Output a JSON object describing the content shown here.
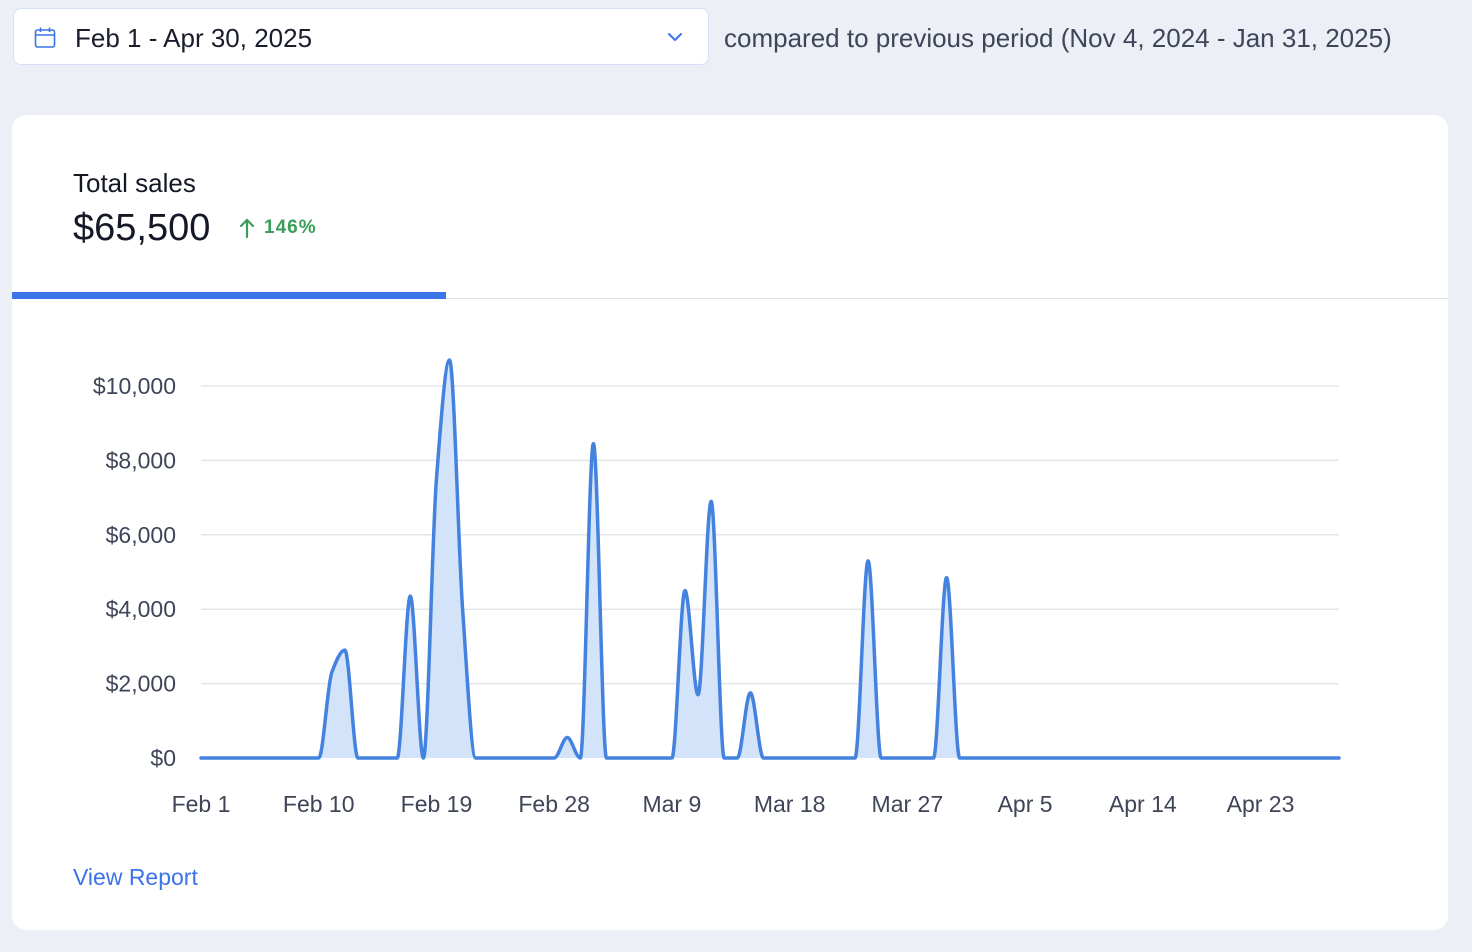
{
  "date_range": {
    "label": "Feb 1 - Apr 30, 2025",
    "icon": "calendar-icon",
    "dropdown_icon": "chevron-down-icon"
  },
  "comparison": {
    "text": "compared to previous period (Nov 4, 2024 - Jan 31, 2025)"
  },
  "metric": {
    "title": "Total sales",
    "value": "$65,500",
    "change": "146%",
    "change_icon": "arrow-up-icon"
  },
  "colors": {
    "accent": "#3b73e8",
    "line": "#4382de",
    "fill": "#d3e3fa",
    "positive": "#3a9d5a"
  },
  "chart_data": {
    "type": "area",
    "title": "",
    "xlabel": "",
    "ylabel": "",
    "ylim": [
      0,
      10000
    ],
    "yticks": [
      0,
      2000,
      4000,
      6000,
      8000,
      10000
    ],
    "ytick_labels": [
      "$0",
      "$2,000",
      "$4,000",
      "$6,000",
      "$8,000",
      "$10,000"
    ],
    "xtick_labels": [
      "Feb 1",
      "Feb 10",
      "Feb 19",
      "Feb 28",
      "Mar 9",
      "Mar 18",
      "Mar 27",
      "Apr 5",
      "Apr 14",
      "Apr 23"
    ],
    "x_start": "2025-02-01",
    "x_end": "2025-04-29",
    "grid": true,
    "series": [
      {
        "points": [
          {
            "x": "2025-02-01",
            "y": 0
          },
          {
            "x": "2025-02-10",
            "y": 0
          },
          {
            "x": "2025-02-11",
            "y": 2300
          },
          {
            "x": "2025-02-12",
            "y": 2900
          },
          {
            "x": "2025-02-13",
            "y": 0
          },
          {
            "x": "2025-02-16",
            "y": 0
          },
          {
            "x": "2025-02-17",
            "y": 4350
          },
          {
            "x": "2025-02-18",
            "y": 0
          },
          {
            "x": "2025-02-19",
            "y": 7500
          },
          {
            "x": "2025-02-20",
            "y": 10700
          },
          {
            "x": "2025-02-21",
            "y": 4000
          },
          {
            "x": "2025-02-22",
            "y": 0
          },
          {
            "x": "2025-02-28",
            "y": 0
          },
          {
            "x": "2025-03-01",
            "y": 550
          },
          {
            "x": "2025-03-02",
            "y": 0
          },
          {
            "x": "2025-03-03",
            "y": 8450
          },
          {
            "x": "2025-03-04",
            "y": 0
          },
          {
            "x": "2025-03-09",
            "y": 0
          },
          {
            "x": "2025-03-10",
            "y": 4500
          },
          {
            "x": "2025-03-11",
            "y": 1700
          },
          {
            "x": "2025-03-12",
            "y": 6900
          },
          {
            "x": "2025-03-13",
            "y": 0
          },
          {
            "x": "2025-03-14",
            "y": 0
          },
          {
            "x": "2025-03-15",
            "y": 1750
          },
          {
            "x": "2025-03-16",
            "y": 0
          },
          {
            "x": "2025-03-23",
            "y": 0
          },
          {
            "x": "2025-03-24",
            "y": 5300
          },
          {
            "x": "2025-03-25",
            "y": 0
          },
          {
            "x": "2025-03-29",
            "y": 0
          },
          {
            "x": "2025-03-30",
            "y": 4850
          },
          {
            "x": "2025-03-31",
            "y": 0
          },
          {
            "x": "2025-04-29",
            "y": 0
          }
        ]
      }
    ]
  },
  "actions": {
    "view_report": "View Report"
  }
}
